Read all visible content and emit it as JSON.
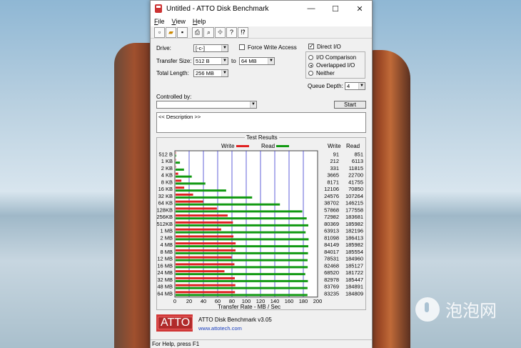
{
  "window": {
    "title": "Untitled - ATTO Disk Benchmark",
    "controls": {
      "minimize": "—",
      "maximize": "☐",
      "close": "✕"
    }
  },
  "menu": [
    {
      "label": "File",
      "key": "F"
    },
    {
      "label": "View",
      "key": "V"
    },
    {
      "label": "Help",
      "key": "H"
    }
  ],
  "toolbar": [
    "new-icon",
    "open-icon",
    "save-icon",
    "print-icon",
    "print-preview-icon",
    "move-icon",
    "help-icon",
    "context-help-icon"
  ],
  "form": {
    "drive_label": "Drive:",
    "drive_value": "[-c-]",
    "transfer_size_label": "Transfer Size:",
    "transfer_from": "512 B",
    "to_label": "to",
    "transfer_to": "64 MB",
    "total_length_label": "Total Length:",
    "total_length": "256 MB",
    "force_write_label": "Force Write Access",
    "force_write_checked": false,
    "direct_io_label": "Direct I/O",
    "direct_io_checked": true,
    "io_options": [
      {
        "label": "I/O Comparison",
        "selected": false
      },
      {
        "label": "Overlapped I/O",
        "selected": true
      },
      {
        "label": "Neither",
        "selected": false
      }
    ],
    "queue_depth_label": "Queue Depth:",
    "queue_depth": "4",
    "controlled_by_label": "Controlled by:",
    "controlled_by_value": "",
    "start_label": "Start",
    "description": "<< Description >>"
  },
  "chart_data": {
    "type": "bar",
    "title": "Test Results",
    "xlabel": "Transfer Rate - MB / Sec",
    "xlim": [
      0,
      200
    ],
    "xticks": [
      "0",
      "20",
      "40",
      "60",
      "80",
      "100",
      "120",
      "140",
      "160",
      "180",
      "200"
    ],
    "col_write": "Write",
    "col_read": "Read",
    "categories": [
      "512 B",
      "1 KB",
      "2 KB",
      "4 KB",
      "8 KB",
      "16 KB",
      "32 KB",
      "64 KB",
      "128KB",
      "256KB",
      "512KB",
      "1 MB",
      "2 MB",
      "4 MB",
      "8 MB",
      "12 MB",
      "16 MB",
      "24 MB",
      "32 MB",
      "48 MB",
      "64 MB"
    ],
    "series": [
      {
        "name": "Write",
        "color": "#e02020",
        "values": [
          91,
          212,
          331,
          3665,
          8171,
          12106,
          24576,
          38702,
          57868,
          72982,
          80369,
          63913,
          81098,
          84149,
          84017,
          78531,
          82468,
          68520,
          82978,
          83769,
          83235
        ]
      },
      {
        "name": "Read",
        "color": "#119911",
        "values": [
          851,
          6113,
          11815,
          22700,
          41755,
          70850,
          107264,
          146215,
          177558,
          183681,
          185982,
          182196,
          186413,
          185982,
          185554,
          184960,
          185127,
          181722,
          185447,
          184891,
          184809
        ]
      }
    ],
    "grid": true,
    "legend": "top"
  },
  "footer": {
    "app_name": "ATTO Disk Benchmark v3.05",
    "url": "www.attotech.com",
    "logo_text": "ATTO"
  },
  "status": "For Help, press F1",
  "watermark": "泡泡网"
}
